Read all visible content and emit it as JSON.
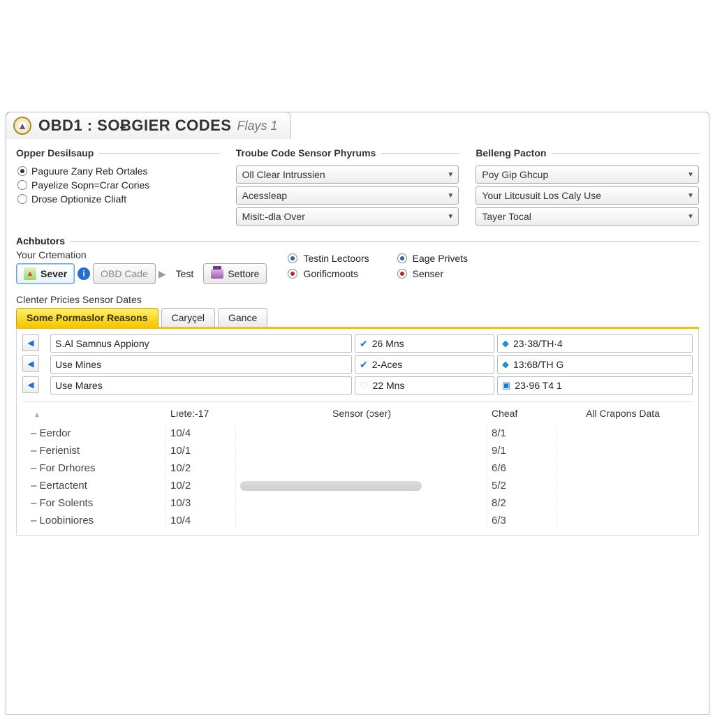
{
  "title": {
    "main": "OBD1 : SOɃGIER CODES",
    "sub": "Flays 1"
  },
  "groups": {
    "opper": {
      "legend": "Opper Desilsaup",
      "options": [
        {
          "label": "Paguure Zany Reb Ortales",
          "selected": true
        },
        {
          "label": "Payelize Sopn=Crar Cories",
          "selected": false
        },
        {
          "label": "Drose Optionize Cliaft",
          "selected": false
        }
      ]
    },
    "troube": {
      "legend": "Troube Code Sensor Phyrums",
      "selects": [
        "Oll Clear Intrussien",
        "Acessleap",
        "Misit:-dla Over"
      ]
    },
    "belleng": {
      "legend": "Belleng Pacton",
      "selects": [
        "Poy Gip Ghcup",
        "Your Litcusuit Los Caly Use",
        "Tayer Tocal"
      ]
    }
  },
  "actions": {
    "legend": "Achbutors",
    "sublabel": "Your Crtemation",
    "sever": "Sever",
    "obdcade": "OBD Cade",
    "test": "Test",
    "settore": "Settore",
    "status": [
      {
        "label": "Testin Lectoors",
        "color": "blue"
      },
      {
        "label": "Eage Privets",
        "color": "blue"
      },
      {
        "label": "Gorificmoots",
        "color": "red"
      },
      {
        "label": "Senser",
        "color": "red"
      }
    ]
  },
  "section_label": "Clenter Pricies Sensor Dates",
  "tabs": [
    {
      "label": "Some Pormaslor Reasons",
      "active": true
    },
    {
      "label": "Caryçel",
      "active": false
    },
    {
      "label": "Gance",
      "active": false
    }
  ],
  "sensor_rows": [
    {
      "name": "S.Al Samnus Appiony",
      "mid": "26 Mns",
      "mid_check": true,
      "right": "23·38/TH·4",
      "right_icon": "diamond"
    },
    {
      "name": "Use Mines",
      "mid": "2-Aces",
      "mid_check": true,
      "right": "13:68/TH G",
      "right_icon": "diamond"
    },
    {
      "name": "Use Mares",
      "mid": "22 Mns",
      "mid_check": false,
      "right": "23·96 T4 1",
      "right_icon": "disk"
    }
  ],
  "table": {
    "headers": {
      "col1": "",
      "col2": "Lıete:-17",
      "col3": "Sensor (ɔser)",
      "col4": "Cheaf",
      "col5": "All Crapons Data"
    },
    "rows": [
      {
        "name": "– Eerdor",
        "lete": "10/4",
        "cheaf": "8/1"
      },
      {
        "name": "– Ferienist",
        "lete": "10/1",
        "cheaf": "9/1"
      },
      {
        "name": "– For Drhores",
        "lete": "10/2",
        "cheaf": "6/6"
      },
      {
        "name": "– Eertactent",
        "lete": "10/2",
        "cheaf": "5/2",
        "bar": true
      },
      {
        "name": "– For Solents",
        "lete": "10/3",
        "cheaf": "8/2"
      },
      {
        "name": "– Loobiniores",
        "lete": "10/4",
        "cheaf": "6/3"
      }
    ]
  }
}
